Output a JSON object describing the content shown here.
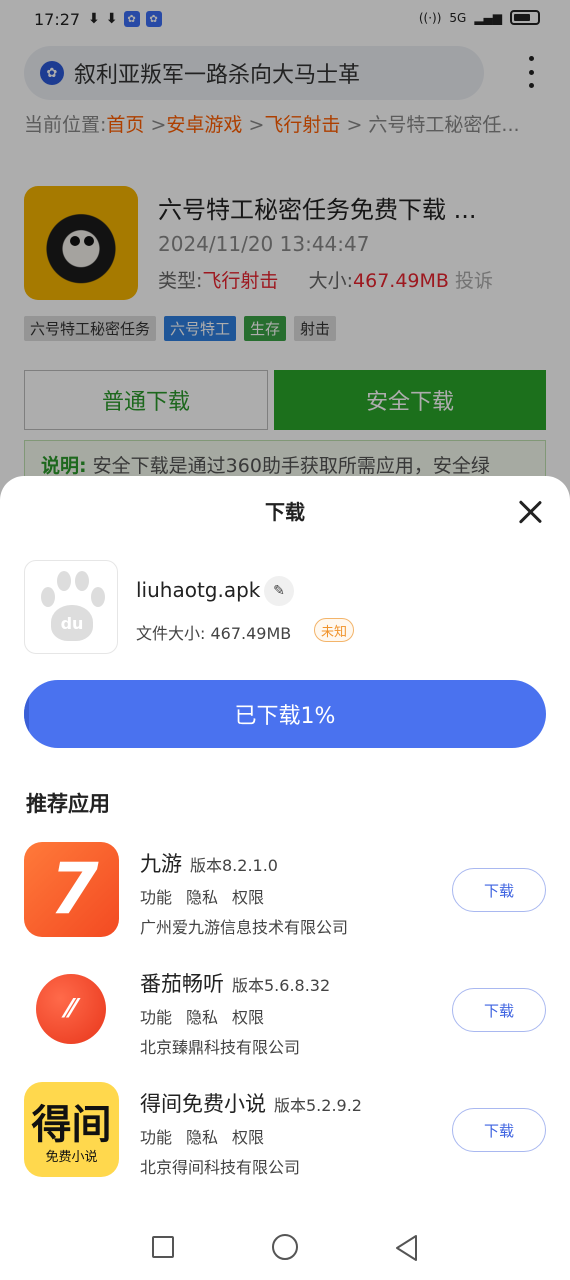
{
  "status_bar": {
    "time": "17:27",
    "network": "5G"
  },
  "browser": {
    "search_text": "叙利亚叛军一路杀向大马士革"
  },
  "breadcrumb": {
    "prefix": "当前位置:",
    "items": [
      "首页",
      "安卓游戏",
      "飞行射击",
      "六号特工秘密任..."
    ]
  },
  "app": {
    "title": "六号特工秘密任务免费下载 ...",
    "date": "2024/11/20 13:44:47",
    "type_label": "类型:",
    "type_value": "飞行射击",
    "size_label": "大小:",
    "size_value": "467.49MB",
    "report": "投诉",
    "tags": [
      "六号特工秘密任务",
      "六号特工",
      "生存",
      "射击"
    ]
  },
  "buttons": {
    "normal_download": "普通下载",
    "safe_download": "安全下载"
  },
  "note": {
    "label": "说明:",
    "text": "安全下载是通过360助手获取所需应用，安全绿"
  },
  "sheet": {
    "title": "下载",
    "file_icon_text": "du",
    "file_name": "liuhaotg.apk",
    "file_size": "文件大小: 467.49MB",
    "unknown_badge": "未知",
    "progress_label": "已下载1%",
    "progress_fraction": 0.01,
    "recommended_title": "推荐应用",
    "apps": [
      {
        "name": "九游",
        "version": "版本8.2.1.0",
        "links": [
          "功能",
          "隐私",
          "权限"
        ],
        "company": "广州爱九游信息技术有限公司",
        "download": "下载"
      },
      {
        "name": "番茄畅听",
        "version": "版本5.6.8.32",
        "links": [
          "功能",
          "隐私",
          "权限"
        ],
        "company": "北京臻鼎科技有限公司",
        "download": "下载"
      },
      {
        "name": "得间免费小说",
        "version": "版本5.2.9.2",
        "links": [
          "功能",
          "隐私",
          "权限"
        ],
        "company": "北京得间科技有限公司",
        "download": "下载",
        "icon_big": "得间",
        "icon_small": "免费小说"
      }
    ]
  },
  "colors": {
    "accent": "#4a72ef",
    "safe_green": "#2aa52a",
    "link_orange": "#ff5e00",
    "warning_red": "#e8242f"
  }
}
